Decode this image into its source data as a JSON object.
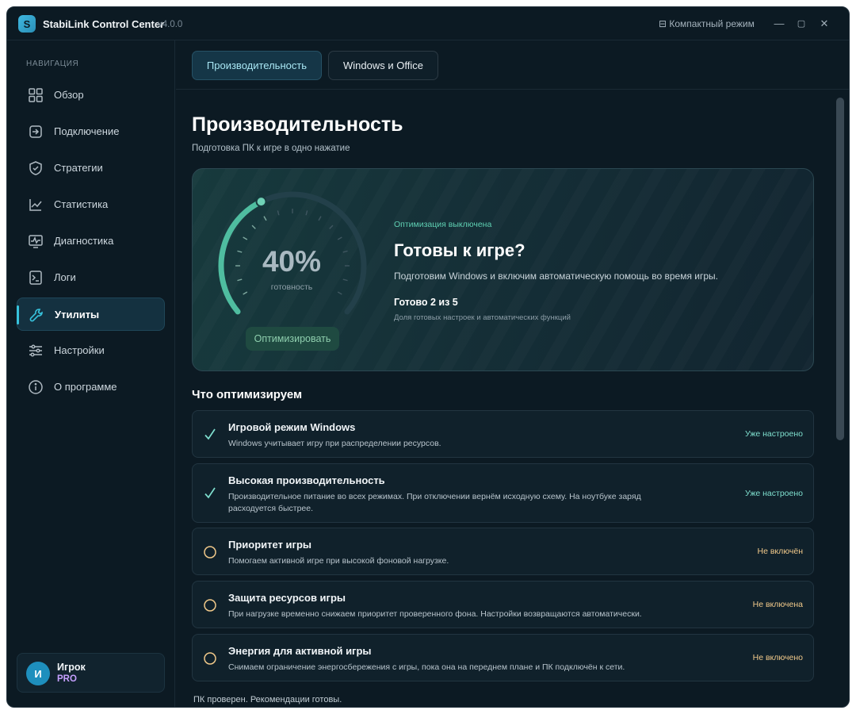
{
  "titlebar": {
    "logo_letter": "S",
    "title": "StabiLink Control Center",
    "version": "v4.0.0",
    "compact_mode": "⊟ Компактный режим",
    "minimize": "—",
    "maximize": "▢",
    "close": "✕"
  },
  "sidebar": {
    "caption": "НАВИГАЦИЯ",
    "items": [
      {
        "label": "Обзор",
        "icon": "grid-icon"
      },
      {
        "label": "Подключение",
        "icon": "login-icon"
      },
      {
        "label": "Стратегии",
        "icon": "shield-icon"
      },
      {
        "label": "Статистика",
        "icon": "chart-icon"
      },
      {
        "label": "Диагностика",
        "icon": "pulse-icon"
      },
      {
        "label": "Логи",
        "icon": "terminal-icon"
      },
      {
        "label": "Утилиты",
        "icon": "wrench-icon",
        "active": true
      },
      {
        "label": "Настройки",
        "icon": "sliders-icon"
      },
      {
        "label": "О программе",
        "icon": "info-icon"
      }
    ],
    "user": {
      "initial": "И",
      "name": "Игрок",
      "plan": "PRO"
    }
  },
  "tabs": [
    {
      "label": "Производительность",
      "active": true
    },
    {
      "label": "Windows и Office",
      "active": false
    }
  ],
  "page": {
    "title": "Производительность",
    "subtitle": "Подготовка ПК к игре в одно нажатие"
  },
  "hero": {
    "gauge_value": "40%",
    "gauge_fraction": 0.4,
    "gauge_label": "готовность",
    "optimize_button": "Оптимизировать",
    "status": "Оптимизация выключена",
    "title": "Готовы к игре?",
    "description": "Подготовим Windows и включим автоматическую помощь во время игры.",
    "ready": "Готово 2 из 5",
    "ready_sub": "Доля готовых настроек и автоматических функций"
  },
  "section": {
    "title": "Что оптимизируем"
  },
  "items": [
    {
      "title": "Игровой режим Windows",
      "desc": "Windows учитывает игру при распределении ресурсов.",
      "status": "Уже настроено",
      "done": true
    },
    {
      "title": "Высокая производительность",
      "desc": "Производительное питание во всех режимах. При отключении вернём исходную схему. На ноутбуке заряд расходуется быстрее.",
      "status": "Уже настроено",
      "done": true
    },
    {
      "title": "Приоритет игры",
      "desc": "Помогаем активной игре при высокой фоновой нагрузке.",
      "status": "Не включён",
      "done": false
    },
    {
      "title": "Защита ресурсов игры",
      "desc": "При нагрузке временно снижаем приоритет проверенного фона. Настройки возвращаются автоматически.",
      "status": "Не включена",
      "done": false
    },
    {
      "title": "Энергия для активной игры",
      "desc": "Снимаем ограничение энергосбережения с игры, пока она на переднем плане и ПК подключён к сети.",
      "status": "Не включено",
      "done": false
    }
  ],
  "footer": {
    "text": "ПК проверен. Рекомендации готовы."
  },
  "colors": {
    "accent": "#37c2dc",
    "ok": "#7fe0cf",
    "off": "#f1c98a",
    "gauge": "#4fbda0",
    "plan": "#c6a0ff"
  }
}
